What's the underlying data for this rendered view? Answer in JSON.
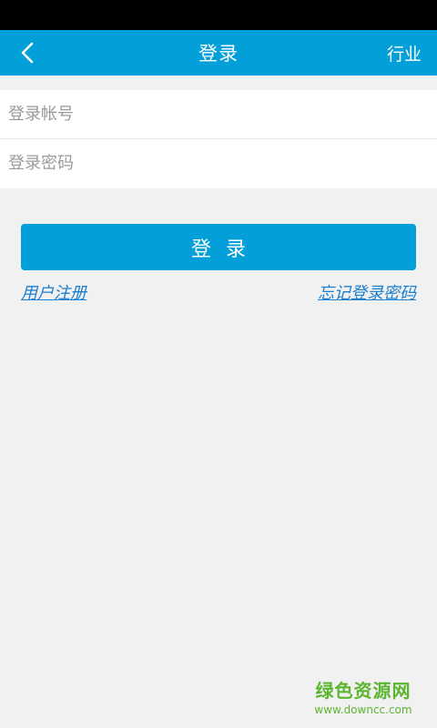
{
  "header": {
    "back_icon": "chevron-left-icon",
    "title": "登录",
    "right_action": "行业"
  },
  "form": {
    "account_placeholder": "登录帐号",
    "password_placeholder": "登录密码"
  },
  "actions": {
    "login_label": "登录",
    "register_link": "用户注册",
    "forgot_link": "忘记登录密码"
  },
  "watermark": {
    "name": "绿色资源网",
    "url": "www.downcc.com"
  },
  "colors": {
    "accent": "#039fd8",
    "link": "#1a7fd0",
    "background": "#f1f1f1",
    "watermark": "#5cb531"
  }
}
